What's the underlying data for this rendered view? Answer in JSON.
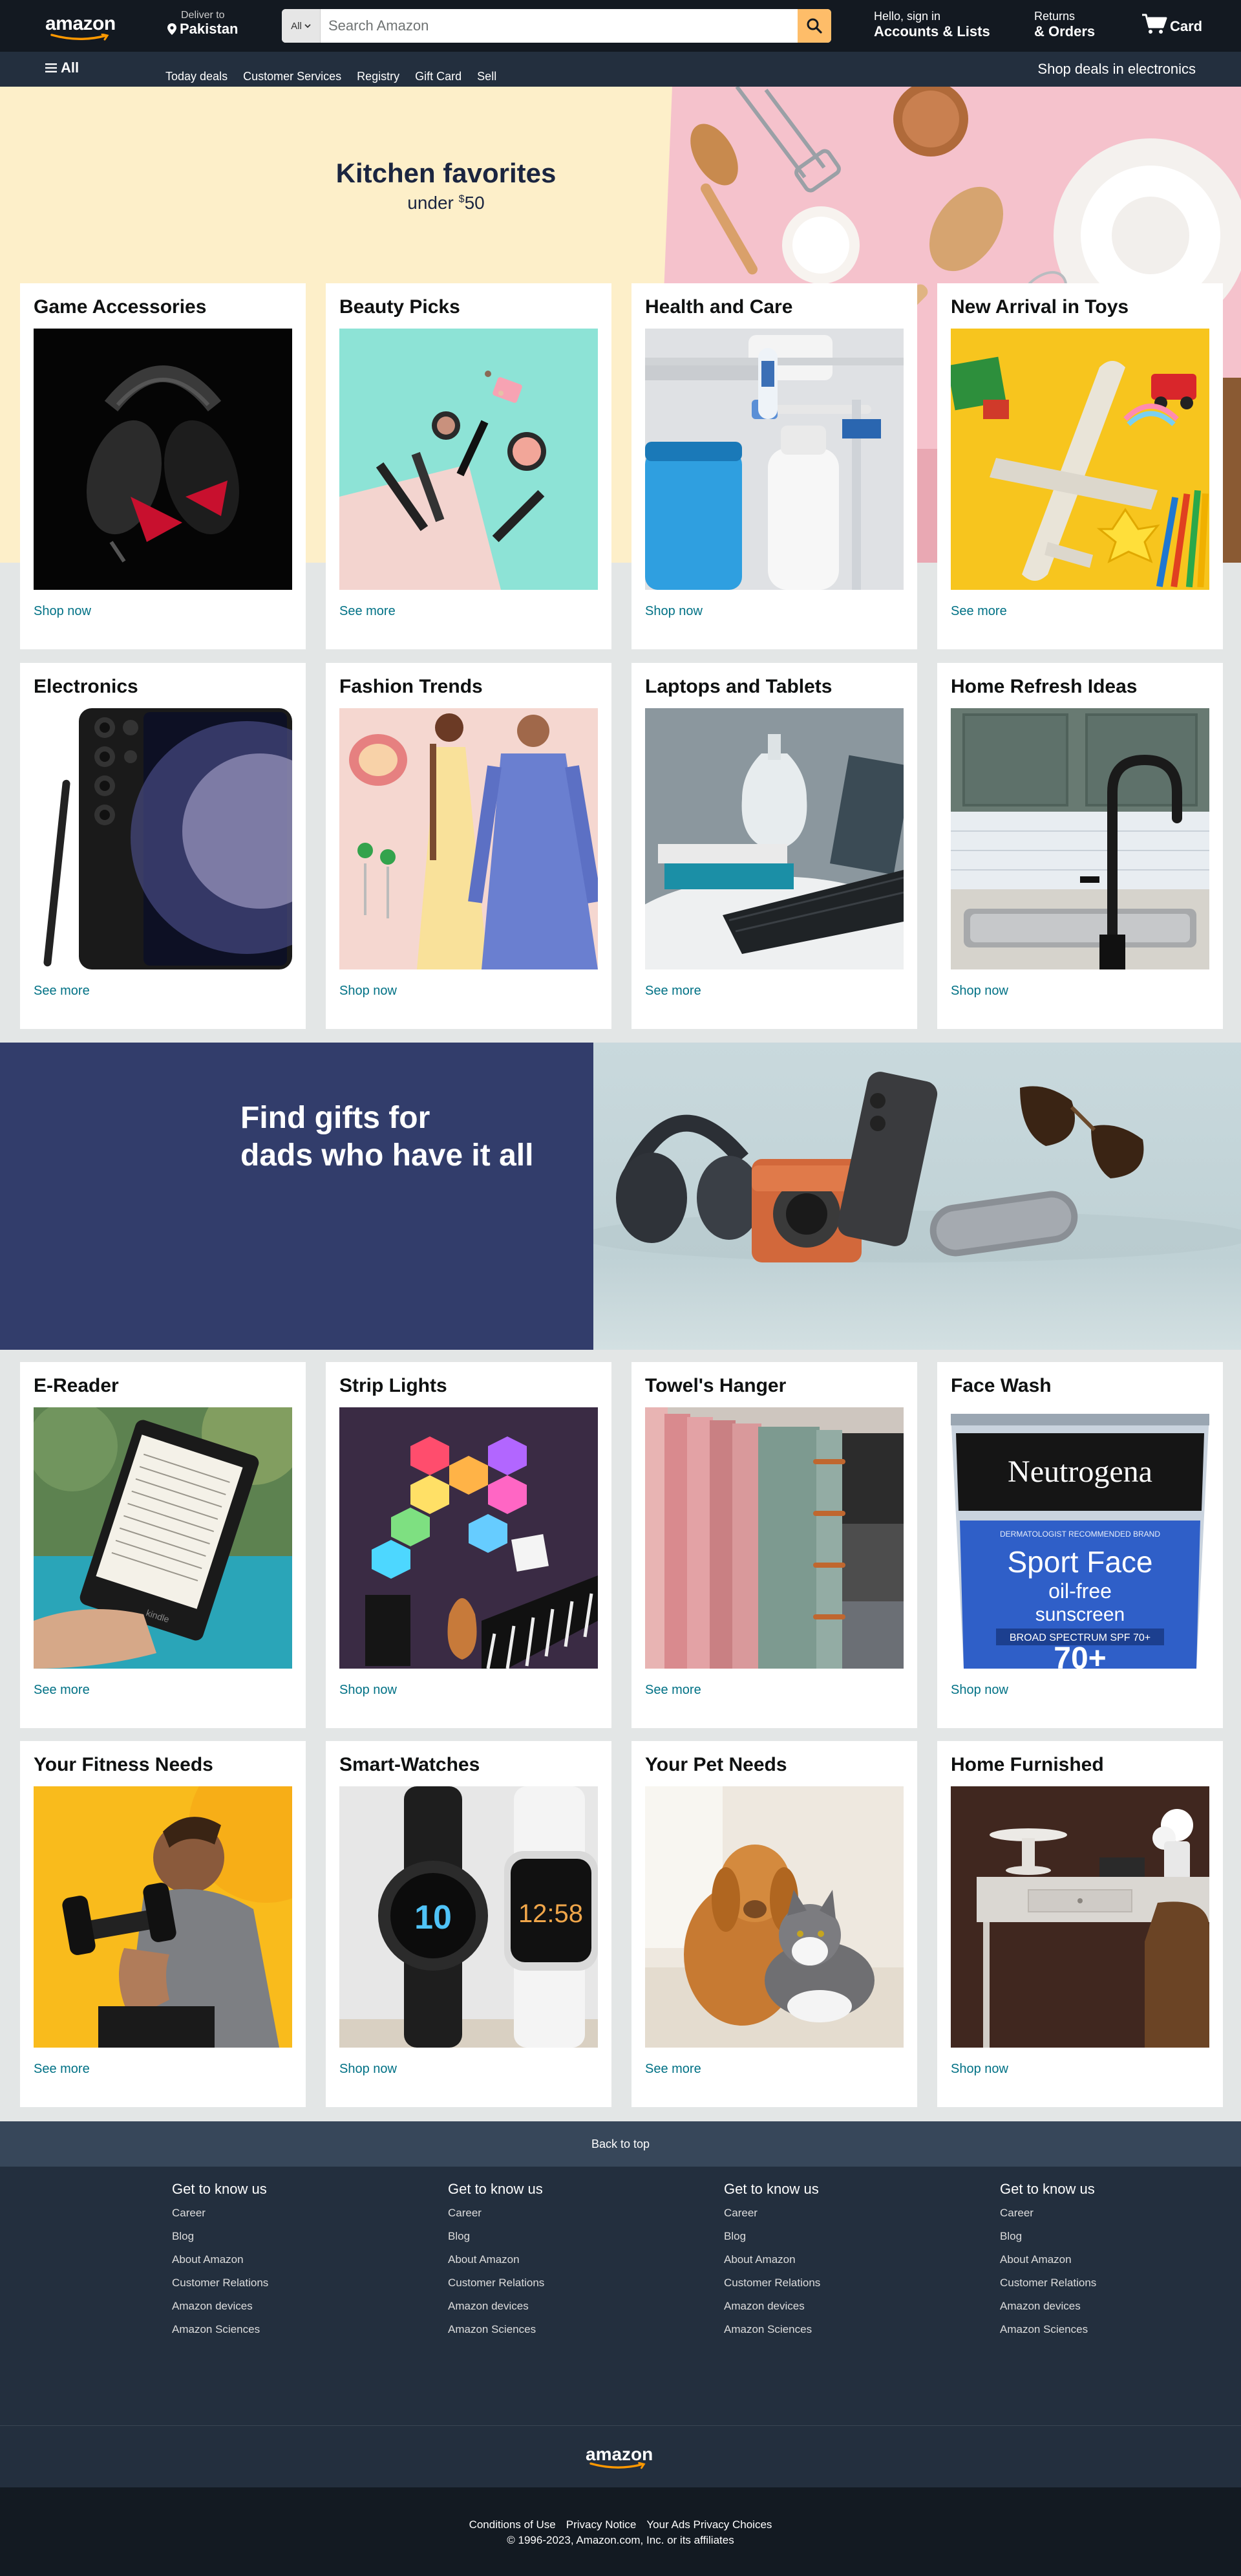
{
  "header": {
    "logo": "amazon",
    "deliver_label": "Deliver to",
    "deliver_location": "Pakistan",
    "search_category": "All",
    "search_placeholder": "Search Amazon",
    "account_line1": "Hello, sign in",
    "account_line2": "Accounts & Lists",
    "returns_line1": "Returns",
    "returns_line2": "& Orders",
    "cart_label": "Card"
  },
  "subnav": {
    "all_label": "All",
    "links": [
      "Today deals",
      "Customer Services",
      "Registry",
      "Gift Card",
      "Sell"
    ],
    "promo": "Shop deals in electronics"
  },
  "hero": {
    "title": "Kitchen favorites",
    "subtitle_prefix": "under ",
    "subtitle_currency": "$",
    "subtitle_amount": "50"
  },
  "cards": [
    {
      "title": "Game Accessories",
      "link": "Shop now"
    },
    {
      "title": "Beauty Picks",
      "link": "See more"
    },
    {
      "title": "Health and Care",
      "link": "Shop now"
    },
    {
      "title": "New Arrival in Toys",
      "link": "See more"
    },
    {
      "title": "Electronics",
      "link": "See more"
    },
    {
      "title": "Fashion Trends",
      "link": "Shop now"
    },
    {
      "title": "Laptops and Tablets",
      "link": "See more"
    },
    {
      "title": "Home Refresh Ideas",
      "link": "Shop now"
    },
    {
      "title": "E-Reader",
      "link": "See more"
    },
    {
      "title": "Strip Lights",
      "link": "Shop now"
    },
    {
      "title": "Towel's Hanger",
      "link": "See more"
    },
    {
      "title": "Face Wash",
      "link": "Shop now"
    },
    {
      "title": "Your Fitness Needs",
      "link": "See more"
    },
    {
      "title": "Smart-Watches",
      "link": "Shop now"
    },
    {
      "title": "Your Pet Needs",
      "link": "See more"
    },
    {
      "title": "Home Furnished",
      "link": "Shop now"
    }
  ],
  "dads_banner": {
    "line1": "Find gifts for",
    "line2": "dads who have it all"
  },
  "product_text": {
    "neutrogena_brand": "Neutrogena",
    "neutrogena_tag": "DERMATOLOGIST RECOMMENDED BRAND",
    "neutrogena_line1": "Sport Face",
    "neutrogena_line2": "oil-free",
    "neutrogena_line3": "sunscreen",
    "neutrogena_spf": "BROAD SPECTRUM SPF 70+",
    "neutrogena_big": "70+",
    "kindle_label": "kindle",
    "watch1_digits": "10",
    "watch2_digits": "12:58"
  },
  "footer": {
    "back_to_top": "Back to top",
    "columns": [
      {
        "heading": "Get to know us",
        "items": [
          "Career",
          "Blog",
          "About Amazon",
          "Customer Relations",
          "Amazon devices",
          "Amazon Sciences"
        ]
      },
      {
        "heading": "Get to know us",
        "items": [
          "Career",
          "Blog",
          "About Amazon",
          "Customer Relations",
          "Amazon devices",
          "Amazon Sciences"
        ]
      },
      {
        "heading": "Get to know us",
        "items": [
          "Career",
          "Blog",
          "About Amazon",
          "Customer Relations",
          "Amazon devices",
          "Amazon Sciences"
        ]
      },
      {
        "heading": "Get to know us",
        "items": [
          "Career",
          "Blog",
          "About Amazon",
          "Customer Relations",
          "Amazon devices",
          "Amazon Sciences"
        ]
      }
    ],
    "logo": "amazon",
    "legal_links": [
      "Conditions of Use",
      "Privacy Notice",
      "Your Ads Privacy Choices"
    ],
    "copyright": "© 1996-2023, Amazon.com, Inc. or its affiliates"
  },
  "colors": {
    "header_bg": "#131921",
    "subnav_bg": "#232f3e",
    "search_button": "#febd69",
    "link": "#007185",
    "hero_cream": "#fdefc9",
    "hero_pink": "#f5c2cc",
    "dads_navy": "#323d6b"
  },
  "icons": {
    "location": "location-pin-icon",
    "caret": "caret-down-icon",
    "search": "search-icon",
    "cart": "cart-icon",
    "menu": "hamburger-menu-icon"
  }
}
